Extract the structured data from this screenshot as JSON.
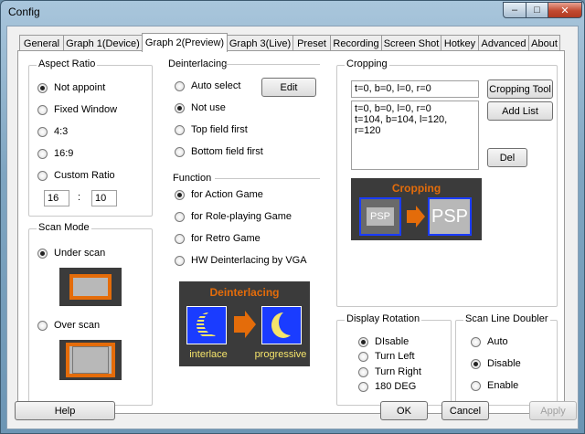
{
  "window": {
    "title": "Config",
    "min": "–",
    "max": "□",
    "close": "✕"
  },
  "tabs": [
    {
      "label": "General"
    },
    {
      "label": "Graph 1(Device)"
    },
    {
      "label": "Graph 2(Preview)"
    },
    {
      "label": "Graph 3(Live)"
    },
    {
      "label": "Preset"
    },
    {
      "label": "Recording"
    },
    {
      "label": "Screen Shot"
    },
    {
      "label": "Hotkey"
    },
    {
      "label": "Advanced"
    },
    {
      "label": "About"
    }
  ],
  "aspect": {
    "title": "Aspect Ratio",
    "options": [
      "Not appoint",
      "Fixed Window",
      "4:3",
      "16:9",
      "Custom Ratio"
    ],
    "ratio_w": "16",
    "ratio_sep": ":",
    "ratio_h": "10"
  },
  "scan": {
    "title": "Scan Mode",
    "under": "Under scan",
    "over": "Over scan"
  },
  "deint": {
    "title": "Deinterlacing",
    "options": [
      "Auto select",
      "Not use",
      "Top field first",
      "Bottom field first"
    ],
    "edit": "Edit",
    "function_label": "Function",
    "functions": [
      "for Action Game",
      "for Role-playing Game",
      "for Retro Game",
      "HW Deinterlacing by VGA"
    ],
    "img_title": "Deinterlacing",
    "img_left": "interlace",
    "img_right": "progressive"
  },
  "crop": {
    "title": "Cropping",
    "value": "t=0, b=0, l=0, r=0",
    "list": [
      "t=0, b=0, l=0, r=0",
      "t=104, b=104, l=120, r=120"
    ],
    "tool": "Cropping Tool",
    "add": "Add List",
    "del": "Del",
    "img_title": "Cropping",
    "psp_small": "PSP",
    "psp_large": "PSP"
  },
  "rotation": {
    "title": "Display Rotation",
    "options": [
      "DIsable",
      "Turn Left",
      "Turn Right",
      "180 DEG"
    ]
  },
  "doubler": {
    "title": "Scan Line Doubler",
    "options": [
      "Auto",
      "Disable",
      "Enable"
    ]
  },
  "footer": {
    "help": "Help",
    "ok": "OK",
    "cancel": "Cancel",
    "apply": "Apply"
  },
  "colors": {
    "accent_orange": "#e46c0a",
    "accent_blue": "#1a3cff",
    "moon_yellow": "#f5e46b"
  }
}
